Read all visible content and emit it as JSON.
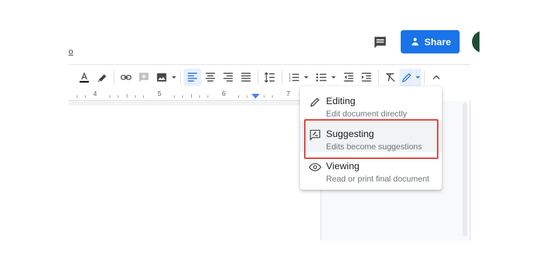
{
  "menu_fragment": "o",
  "header": {
    "share_label": "Share"
  },
  "ruler": {
    "numbers": [
      "4",
      "5",
      "6",
      "7"
    ]
  },
  "mode_menu": {
    "items": [
      {
        "title": "Editing",
        "description": "Edit document directly",
        "icon": "pencil-icon"
      },
      {
        "title": "Suggesting",
        "description": "Edits become suggestions",
        "icon": "suggest-icon"
      },
      {
        "title": "Viewing",
        "description": "Read or print final document",
        "icon": "eye-icon"
      }
    ],
    "highlighted_item": "Suggesting"
  },
  "colors": {
    "accent": "#1a73e8",
    "highlight_border": "#e53935",
    "active_button_bg": "#e8f0fe"
  }
}
